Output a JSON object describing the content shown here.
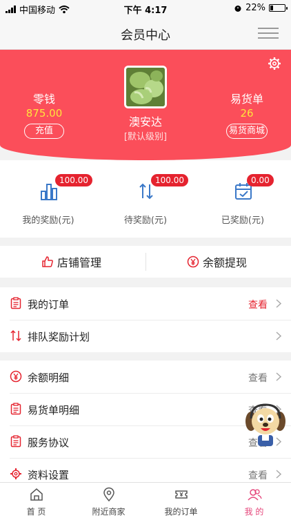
{
  "status_bar": {
    "carrier": "中国移动",
    "time": "下午 4:17",
    "battery": "22%",
    "battery_level": 0.22
  },
  "nav": {
    "title": "会员中心"
  },
  "profile": {
    "name": "澳安达",
    "level": "[默认级别]",
    "balance": {
      "title": "零钱",
      "value": "875.00",
      "button": "充值"
    },
    "exchange": {
      "title": "易货单",
      "value": "26",
      "button": "易货商城"
    }
  },
  "rewards": [
    {
      "label": "我的奖励(元)",
      "badge": "100.00",
      "icon": "bar-chart-icon"
    },
    {
      "label": "待奖励(元)",
      "badge": "100.00",
      "icon": "sort-arrows-icon"
    },
    {
      "label": "已奖励(元)",
      "badge": "0.00",
      "icon": "calendar-check-icon"
    }
  ],
  "quick": {
    "shop": "店铺管理",
    "withdraw": "余额提现"
  },
  "list_group1": [
    {
      "label": "我的订单",
      "action": "查看",
      "icon": "clipboard-icon"
    },
    {
      "label": "排队奖励计划",
      "action": "",
      "icon": "sort-arrows-icon"
    }
  ],
  "list_group2": [
    {
      "label": "余额明细",
      "action": "查看",
      "icon": "yen-circle-icon"
    },
    {
      "label": "易货单明细",
      "action": "查看",
      "icon": "clipboard-icon"
    },
    {
      "label": "服务协议",
      "action": "查看",
      "icon": "clipboard-icon"
    },
    {
      "label": "资料设置",
      "action": "查看",
      "icon": "gear-icon"
    }
  ],
  "tabs": [
    {
      "label": "首 页",
      "icon": "home-icon"
    },
    {
      "label": "附近商家",
      "icon": "location-pin-icon"
    },
    {
      "label": "我的订单",
      "icon": "ticket-icon"
    },
    {
      "label": "我 的",
      "icon": "user-group-icon"
    }
  ],
  "colors": {
    "header_red": "#fb4e5a",
    "badge_red": "#e5232f",
    "value_yellow": "#ffe43c",
    "icon_blue": "#3a78c8",
    "tab_active": "#e5457a"
  }
}
